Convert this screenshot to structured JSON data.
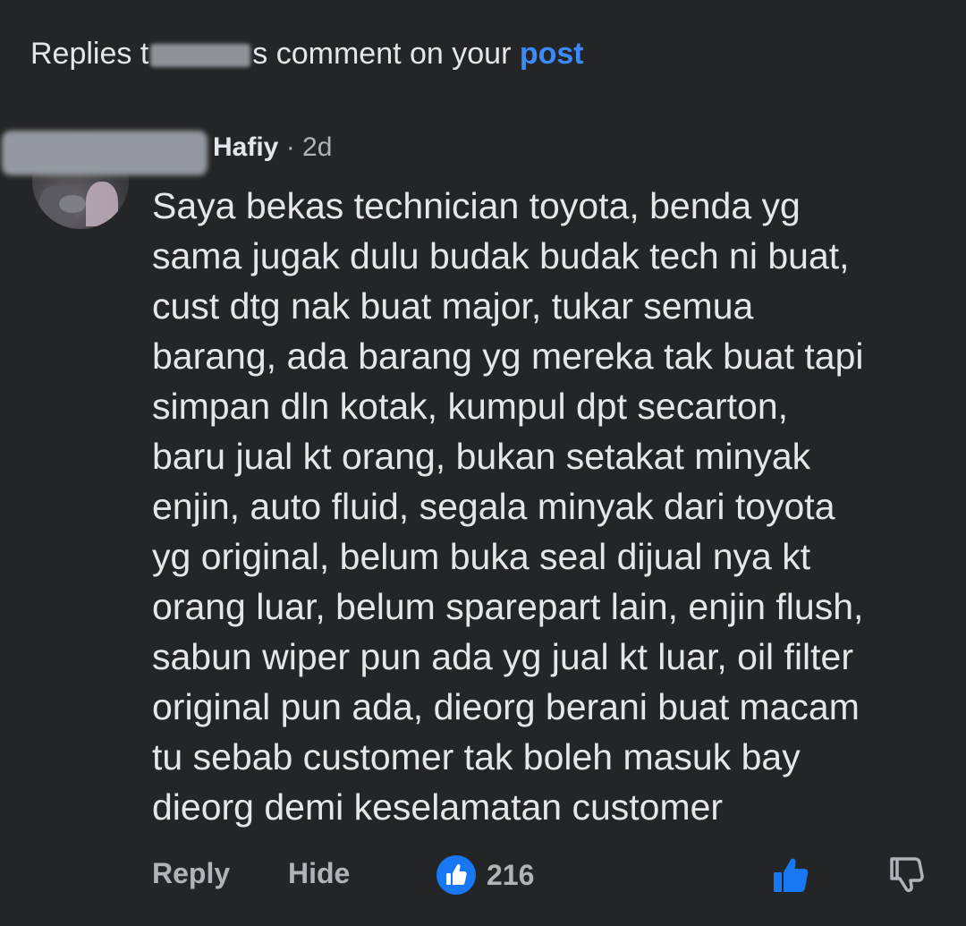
{
  "header": {
    "prefix": "Replies t",
    "suffix": "s comment on your ",
    "link": "post"
  },
  "comment": {
    "author": "Hafiy",
    "separator": "·",
    "time": "2d",
    "lines": [
      "Saya bekas technician toyota, benda yg",
      "sama jugak dulu budak budak tech ni buat,",
      "cust dtg nak buat major, tukar semua",
      "barang, ada barang yg mereka tak buat tapi",
      "simpan dln kotak, kumpul dpt secarton,",
      "baru jual kt orang, bukan setakat minyak",
      "enjin, auto fluid, segala minyak dari toyota",
      "yg original, belum buka seal dijual nya kt",
      "orang luar, belum sparepart lain, enjin flush,",
      "sabun wiper pun ada yg jual kt luar, oil filter",
      "original pun ada, dieorg berani buat macam",
      "tu sebab customer tak boleh masuk bay",
      "dieorg demi keselamatan customer"
    ]
  },
  "actions": {
    "reply_label": "Reply",
    "hide_label": "Hide",
    "like_count": "216"
  },
  "icons": {
    "like_badge": "thumbs-up-icon",
    "like_button": "thumbs-up-icon",
    "dislike_button": "thumbs-down-icon"
  },
  "colors": {
    "background": "#242526",
    "text": "#e4e6eb",
    "secondary_text": "#b0b3b8",
    "link": "#3b8bff",
    "like_blue": "#1877f2"
  }
}
